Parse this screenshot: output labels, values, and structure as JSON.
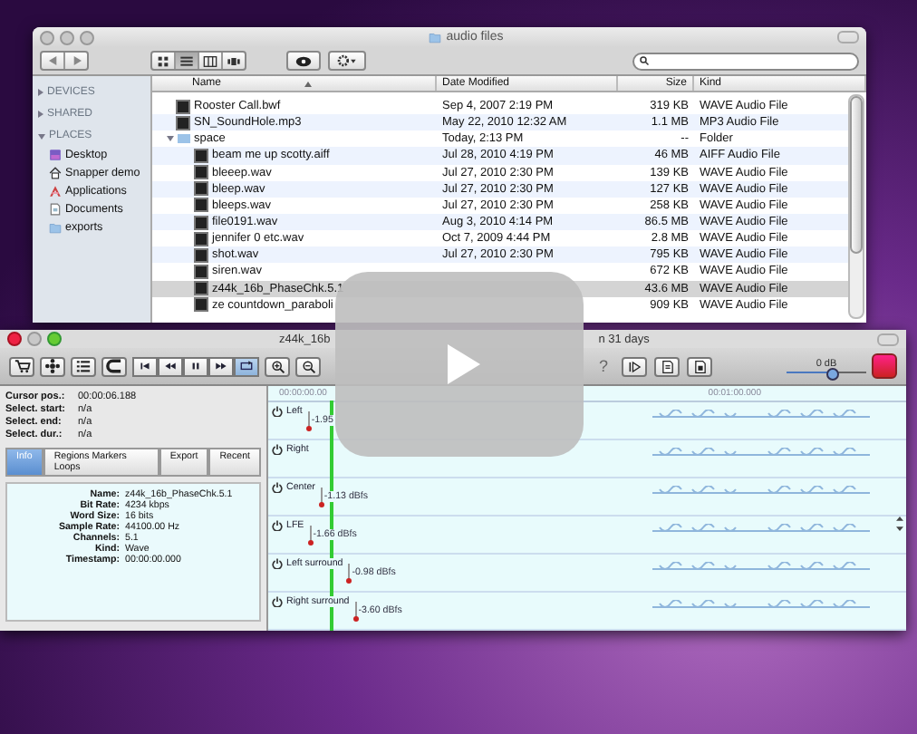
{
  "finder": {
    "title": "audio files",
    "views": [
      {
        "kind": "icon",
        "selected": false
      },
      {
        "kind": "list",
        "selected": true
      },
      {
        "kind": "column",
        "selected": false
      },
      {
        "kind": "flow",
        "selected": false
      }
    ],
    "sidebar": [
      {
        "heading": "DEVICES",
        "expanded": false
      },
      {
        "heading": "SHARED",
        "expanded": false
      },
      {
        "heading": "PLACES",
        "expanded": true,
        "items": [
          {
            "label": "Desktop",
            "kind": "desktop"
          },
          {
            "label": "Snapper demo",
            "kind": "home"
          },
          {
            "label": "Applications",
            "kind": "apps"
          },
          {
            "label": "Documents",
            "kind": "docs"
          },
          {
            "label": "exports",
            "kind": "folder"
          }
        ]
      }
    ],
    "columns": [
      "Name",
      "Date Modified",
      "Size",
      "Kind"
    ],
    "rows": [
      {
        "kind": "file",
        "name": "Rooster Call.bwf",
        "date": "Sep 4, 2007 2:19 PM",
        "size": "319 KB",
        "file_type": "WAVE Audio File",
        "selected": false
      },
      {
        "kind": "file",
        "name": "SN_SoundHole.mp3",
        "date": "May 22, 2010 12:32 AM",
        "size": "1.1 MB",
        "file_type": "MP3 Audio File",
        "selected": false
      },
      {
        "kind": "folder",
        "name": "space",
        "date": "Today, 2:13 PM",
        "size": "--",
        "file_type": "Folder",
        "selected": false,
        "expanded": true,
        "children": [
          {
            "kind": "file",
            "name": "beam me up scotty.aiff",
            "date": "Jul 28, 2010 4:19 PM",
            "size": "46 MB",
            "file_type": "AIFF Audio File",
            "selected": false
          },
          {
            "kind": "file",
            "name": "bleeep.wav",
            "date": "Jul 27, 2010 2:30 PM",
            "size": "139 KB",
            "file_type": "WAVE Audio File",
            "selected": false
          },
          {
            "kind": "file",
            "name": "bleep.wav",
            "date": "Jul 27, 2010 2:30 PM",
            "size": "127 KB",
            "file_type": "WAVE Audio File",
            "selected": false
          },
          {
            "kind": "file",
            "name": "bleeps.wav",
            "date": "Jul 27, 2010 2:30 PM",
            "size": "258 KB",
            "file_type": "WAVE Audio File",
            "selected": false
          },
          {
            "kind": "file",
            "name": "file0191.wav",
            "date": "Aug 3, 2010 4:14 PM",
            "size": "86.5 MB",
            "file_type": "WAVE Audio File",
            "selected": false
          },
          {
            "kind": "file",
            "name": "jennifer 0 etc.wav",
            "date": "Oct 7, 2009 4:44 PM",
            "size": "2.8 MB",
            "file_type": "WAVE Audio File",
            "selected": false
          },
          {
            "kind": "file",
            "name": "shot.wav",
            "date": "Jul 27, 2010 2:30 PM",
            "size": "795 KB",
            "file_type": "WAVE Audio File",
            "selected": false
          },
          {
            "kind": "file",
            "name": "siren.wav",
            "size": "672 KB",
            "file_type": "WAVE Audio File",
            "selected": false
          },
          {
            "kind": "file",
            "name": "z44k_16b_PhaseChk.5.1",
            "size": "43.6 MB",
            "file_type": "WAVE Audio File",
            "selected": true
          },
          {
            "kind": "file",
            "name": "ze countdown_paraboli",
            "size": "909 KB",
            "file_type": "WAVE Audio File",
            "selected": false
          }
        ]
      }
    ]
  },
  "editor": {
    "title_parts": [
      "z44k_16b",
      "n 31 days"
    ],
    "toolbar": [
      {
        "kind": "cart"
      },
      {
        "kind": "flower"
      },
      {
        "kind": "list"
      },
      {
        "kind": "magnet"
      }
    ],
    "transport": [
      {
        "kind": "skip-back",
        "selected": false
      },
      {
        "kind": "rewind",
        "selected": false
      },
      {
        "kind": "pause",
        "selected": false
      },
      {
        "kind": "forward",
        "selected": false
      },
      {
        "kind": "loop",
        "selected": true
      }
    ],
    "zoom": [
      {
        "kind": "zoom-in"
      },
      {
        "kind": "zoom-out"
      }
    ],
    "toolbar_right": [
      {
        "kind": "help",
        "label": "?"
      },
      {
        "kind": "play-to"
      },
      {
        "kind": "doc"
      },
      {
        "kind": "doc-save"
      }
    ],
    "volume": {
      "label": "0 dB",
      "level": 0.55
    },
    "status": [
      {
        "label": "Cursor pos.:",
        "value": "00:00:06.188"
      },
      {
        "label": "Select. start:",
        "value": "n/a"
      },
      {
        "label": "Select. end:",
        "value": "n/a"
      },
      {
        "label": "Select. dur.:",
        "value": "n/a"
      }
    ],
    "tabs": [
      {
        "label": "Info",
        "selected": true
      },
      {
        "label": "Regions Markers Loops",
        "selected": false
      },
      {
        "label": "Export",
        "selected": false
      },
      {
        "label": "Recent",
        "selected": false
      }
    ],
    "info": [
      {
        "label": "Name:",
        "value": "z44k_16b_PhaseChk.5.1"
      },
      {
        "label": "Bit Rate:",
        "value": "4234 kbps"
      },
      {
        "label": "Word Size:",
        "value": "16 bits"
      },
      {
        "label": "Sample Rate:",
        "value": "44100.00 Hz"
      },
      {
        "label": "Channels:",
        "value": "5.1"
      },
      {
        "label": "Kind:",
        "value": "Wave"
      },
      {
        "label": "Timestamp:",
        "value": "00:00:00.000"
      }
    ],
    "ruler": [
      "00:00:00.00",
      "00:01:00.000"
    ],
    "channels": [
      {
        "name": "Left",
        "reading": "-1.95"
      },
      {
        "name": "Right"
      },
      {
        "name": "Center",
        "reading": "-1.13 dBfs"
      },
      {
        "name": "LFE",
        "reading": "-1.66 dBfs"
      },
      {
        "name": "Left surround",
        "reading": "-0.98 dBfs"
      },
      {
        "name": "Right surround",
        "reading": "-3.60 dBfs"
      }
    ]
  }
}
